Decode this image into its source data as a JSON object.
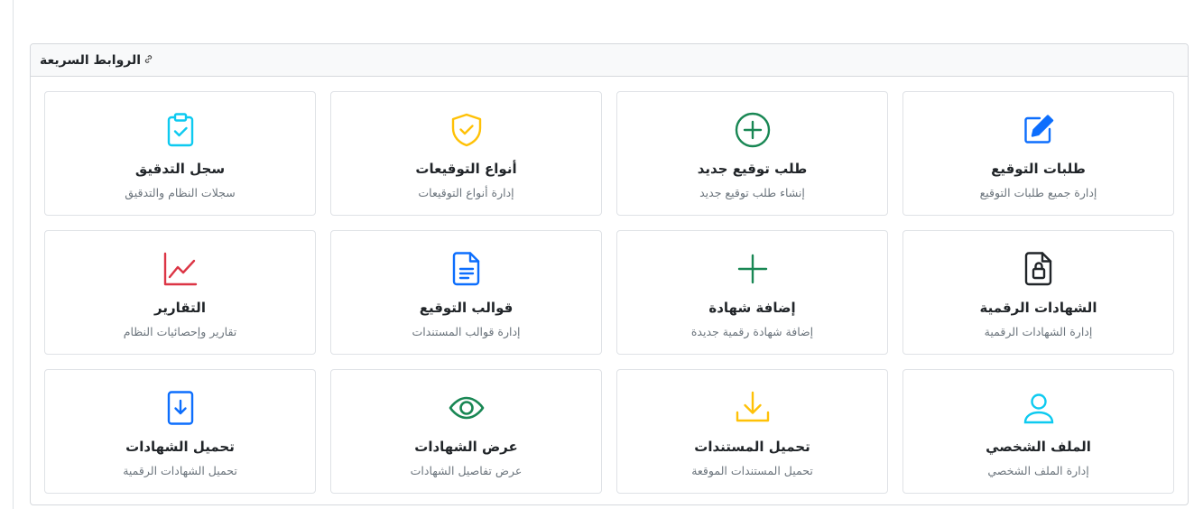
{
  "header": {
    "title": "الروابط السريعة",
    "icon": "link-icon"
  },
  "colors": {
    "blue": "#0d6efd",
    "green": "#198754",
    "yellow": "#ffc107",
    "cyan": "#0dcaf0",
    "red": "#dc3545",
    "dark": "#212529"
  },
  "tiles": [
    {
      "title": "طلبات التوقيع",
      "desc": "إدارة جميع طلبات التوقيع",
      "icon": "pencil-square-icon"
    },
    {
      "title": "طلب توقيع جديد",
      "desc": "إنشاء طلب توقيع جديد",
      "icon": "plus-circle-icon"
    },
    {
      "title": "أنواع التوقيعات",
      "desc": "إدارة أنواع التوقيعات",
      "icon": "shield-check-icon"
    },
    {
      "title": "سجل التدقيق",
      "desc": "سجلات النظام والتدقيق",
      "icon": "clipboard-check-icon"
    },
    {
      "title": "الشهادات الرقمية",
      "desc": "إدارة الشهادات الرقمية",
      "icon": "file-lock-icon"
    },
    {
      "title": "إضافة شهادة",
      "desc": "إضافة شهادة رقمية جديدة",
      "icon": "plus-icon"
    },
    {
      "title": "قوالب التوقيع",
      "desc": "إدارة قوالب المستندات",
      "icon": "file-text-icon"
    },
    {
      "title": "التقارير",
      "desc": "تقارير وإحصائيات النظام",
      "icon": "graph-up-icon"
    },
    {
      "title": "الملف الشخصي",
      "desc": "إدارة الملف الشخصي",
      "icon": "person-icon"
    },
    {
      "title": "تحميل المستندات",
      "desc": "تحميل المستندات الموقعة",
      "icon": "download-icon"
    },
    {
      "title": "عرض الشهادات",
      "desc": "عرض تفاصيل الشهادات",
      "icon": "eye-icon"
    },
    {
      "title": "تحميل الشهادات",
      "desc": "تحميل الشهادات الرقمية",
      "icon": "file-arrow-down-icon"
    }
  ]
}
